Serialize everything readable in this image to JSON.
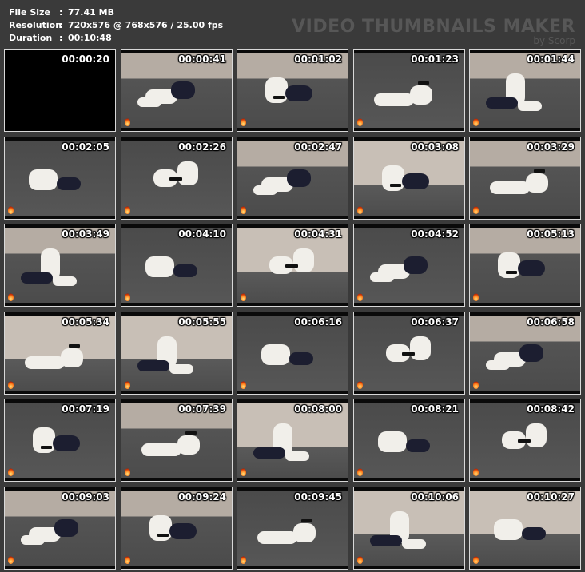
{
  "meta": {
    "file_size_label": "File Size",
    "file_size": "77.41 MB",
    "resolution_label": "Resolution",
    "resolution": "720x576 @ 768x576 / 25.00 fps",
    "duration_label": "Duration",
    "duration": "00:10:48",
    "colon": ":"
  },
  "brand": {
    "title": "VIDEO THUMBNAILS MAKER",
    "subtitle": "by Scorp"
  },
  "thumbnails": [
    {
      "time": "00:00:20",
      "scene": "black"
    },
    {
      "time": "00:00:41",
      "scene": "room"
    },
    {
      "time": "00:01:02",
      "scene": "room"
    },
    {
      "time": "00:01:23",
      "scene": "floor"
    },
    {
      "time": "00:01:44",
      "scene": "room"
    },
    {
      "time": "00:02:05",
      "scene": "floor"
    },
    {
      "time": "00:02:26",
      "scene": "floor"
    },
    {
      "time": "00:02:47",
      "scene": "room"
    },
    {
      "time": "00:03:08",
      "scene": "wall"
    },
    {
      "time": "00:03:29",
      "scene": "room"
    },
    {
      "time": "00:03:49",
      "scene": "room"
    },
    {
      "time": "00:04:10",
      "scene": "floor"
    },
    {
      "time": "00:04:31",
      "scene": "wall"
    },
    {
      "time": "00:04:52",
      "scene": "floor"
    },
    {
      "time": "00:05:13",
      "scene": "room"
    },
    {
      "time": "00:05:34",
      "scene": "wall"
    },
    {
      "time": "00:05:55",
      "scene": "wall"
    },
    {
      "time": "00:06:16",
      "scene": "floor"
    },
    {
      "time": "00:06:37",
      "scene": "floor"
    },
    {
      "time": "00:06:58",
      "scene": "room"
    },
    {
      "time": "00:07:19",
      "scene": "floor"
    },
    {
      "time": "00:07:39",
      "scene": "room"
    },
    {
      "time": "00:08:00",
      "scene": "wall"
    },
    {
      "time": "00:08:21",
      "scene": "floor"
    },
    {
      "time": "00:08:42",
      "scene": "floor"
    },
    {
      "time": "00:09:03",
      "scene": "room"
    },
    {
      "time": "00:09:24",
      "scene": "room"
    },
    {
      "time": "00:09:45",
      "scene": "floor"
    },
    {
      "time": "00:10:06",
      "scene": "wall"
    },
    {
      "time": "00:10:27",
      "scene": "wall"
    }
  ],
  "colors": {
    "background": "#3a3a3a",
    "text": "#ffffff",
    "brand": "#575757",
    "thumb_border": "#d8d8d8"
  }
}
